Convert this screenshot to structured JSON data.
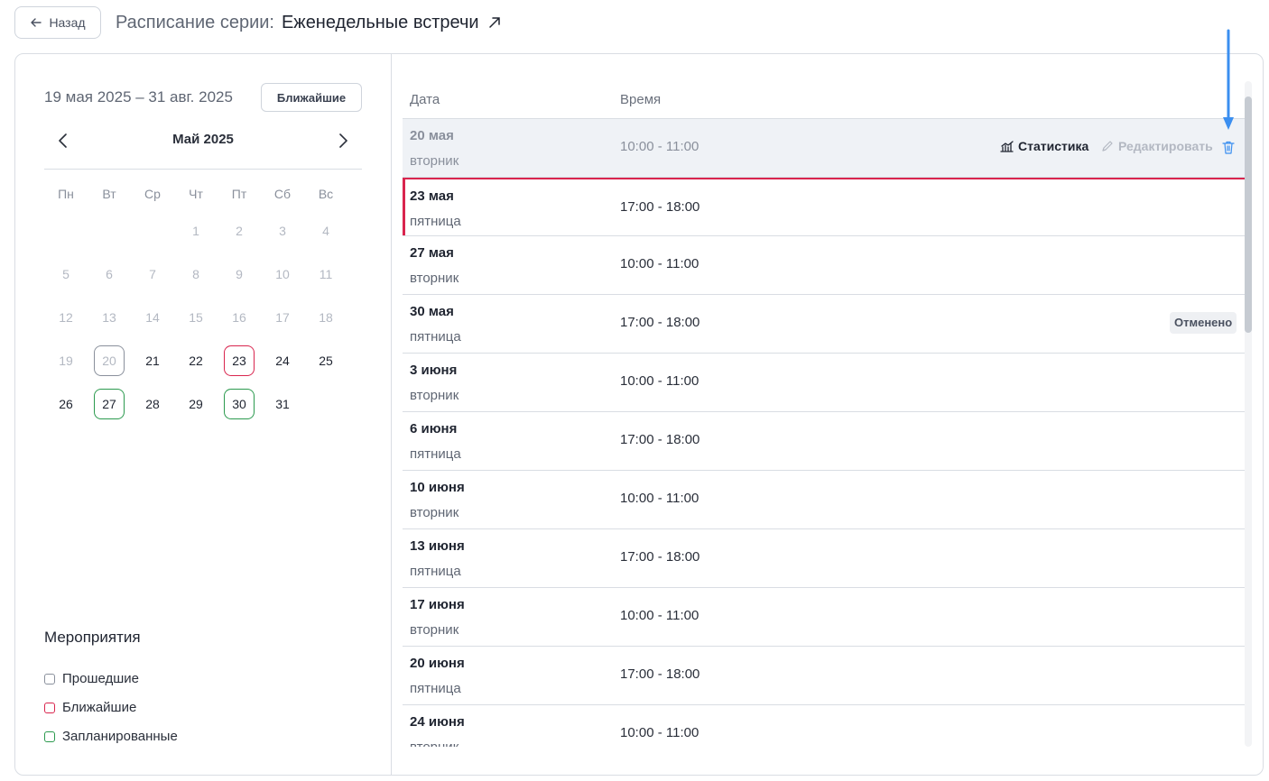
{
  "header": {
    "back_label": "Назад",
    "title_prefix": "Расписание серии:",
    "series_name": "Еженедельные встречи"
  },
  "calendar": {
    "range": "19 мая 2025 – 31 авг. 2025",
    "nearest_label": "Ближайшие",
    "month": "Май 2025",
    "weekdays": [
      "Пн",
      "Вт",
      "Ср",
      "Чт",
      "Пт",
      "Сб",
      "Вс"
    ],
    "days": [
      {
        "n": "",
        "state": "empty",
        "mark": ""
      },
      {
        "n": "",
        "state": "empty",
        "mark": ""
      },
      {
        "n": "",
        "state": "empty",
        "mark": ""
      },
      {
        "n": "1",
        "state": "past",
        "mark": ""
      },
      {
        "n": "2",
        "state": "past",
        "mark": ""
      },
      {
        "n": "3",
        "state": "past",
        "mark": ""
      },
      {
        "n": "4",
        "state": "past",
        "mark": ""
      },
      {
        "n": "5",
        "state": "past",
        "mark": ""
      },
      {
        "n": "6",
        "state": "past",
        "mark": ""
      },
      {
        "n": "7",
        "state": "past",
        "mark": ""
      },
      {
        "n": "8",
        "state": "past",
        "mark": ""
      },
      {
        "n": "9",
        "state": "past",
        "mark": ""
      },
      {
        "n": "10",
        "state": "past",
        "mark": ""
      },
      {
        "n": "11",
        "state": "past",
        "mark": ""
      },
      {
        "n": "12",
        "state": "past",
        "mark": ""
      },
      {
        "n": "13",
        "state": "past",
        "mark": ""
      },
      {
        "n": "14",
        "state": "past",
        "mark": ""
      },
      {
        "n": "15",
        "state": "past",
        "mark": ""
      },
      {
        "n": "16",
        "state": "past",
        "mark": ""
      },
      {
        "n": "17",
        "state": "past",
        "mark": ""
      },
      {
        "n": "18",
        "state": "past",
        "mark": ""
      },
      {
        "n": "19",
        "state": "past",
        "mark": ""
      },
      {
        "n": "20",
        "state": "past",
        "mark": "past"
      },
      {
        "n": "21",
        "state": "cur",
        "mark": ""
      },
      {
        "n": "22",
        "state": "cur",
        "mark": ""
      },
      {
        "n": "23",
        "state": "cur",
        "mark": "near"
      },
      {
        "n": "24",
        "state": "cur",
        "mark": ""
      },
      {
        "n": "25",
        "state": "cur",
        "mark": ""
      },
      {
        "n": "26",
        "state": "cur",
        "mark": ""
      },
      {
        "n": "27",
        "state": "cur",
        "mark": "plan"
      },
      {
        "n": "28",
        "state": "cur",
        "mark": ""
      },
      {
        "n": "29",
        "state": "cur",
        "mark": ""
      },
      {
        "n": "30",
        "state": "cur",
        "mark": "plan"
      },
      {
        "n": "31",
        "state": "cur",
        "mark": ""
      }
    ]
  },
  "legend": {
    "title": "Мероприятия",
    "past": "Прошедшие",
    "near": "Ближайшие",
    "planned": "Запланированные"
  },
  "table": {
    "col_date": "Дата",
    "col_time": "Время",
    "stats_label": "Статистика",
    "edit_label": "Редактировать",
    "rows": [
      {
        "date": "20 мая",
        "weekday": "вторник",
        "time": "10:00 - 11:00",
        "status": "past",
        "badge": ""
      },
      {
        "date": "23 мая",
        "weekday": "пятница",
        "time": "17:00 - 18:00",
        "status": "near",
        "badge": ""
      },
      {
        "date": "27 мая",
        "weekday": "вторник",
        "time": "10:00 - 11:00",
        "status": "",
        "badge": ""
      },
      {
        "date": "30 мая",
        "weekday": "пятница",
        "time": "17:00 - 18:00",
        "status": "",
        "badge": "Отменено"
      },
      {
        "date": "3 июня",
        "weekday": "вторник",
        "time": "10:00 - 11:00",
        "status": "",
        "badge": ""
      },
      {
        "date": "6 июня",
        "weekday": "пятница",
        "time": "17:00 - 18:00",
        "status": "",
        "badge": ""
      },
      {
        "date": "10 июня",
        "weekday": "вторник",
        "time": "10:00 - 11:00",
        "status": "",
        "badge": ""
      },
      {
        "date": "13 июня",
        "weekday": "пятница",
        "time": "17:00 - 18:00",
        "status": "",
        "badge": ""
      },
      {
        "date": "17 июня",
        "weekday": "вторник",
        "time": "10:00 - 11:00",
        "status": "",
        "badge": ""
      },
      {
        "date": "20 июня",
        "weekday": "пятница",
        "time": "17:00 - 18:00",
        "status": "",
        "badge": ""
      },
      {
        "date": "24 июня",
        "weekday": "вторник",
        "time": "10:00 - 11:00",
        "status": "",
        "badge": ""
      }
    ]
  },
  "colors": {
    "near": "#d9254e",
    "planned": "#2b9a4e",
    "past": "#8a909c",
    "annotation_arrow": "#3b8ff0"
  }
}
